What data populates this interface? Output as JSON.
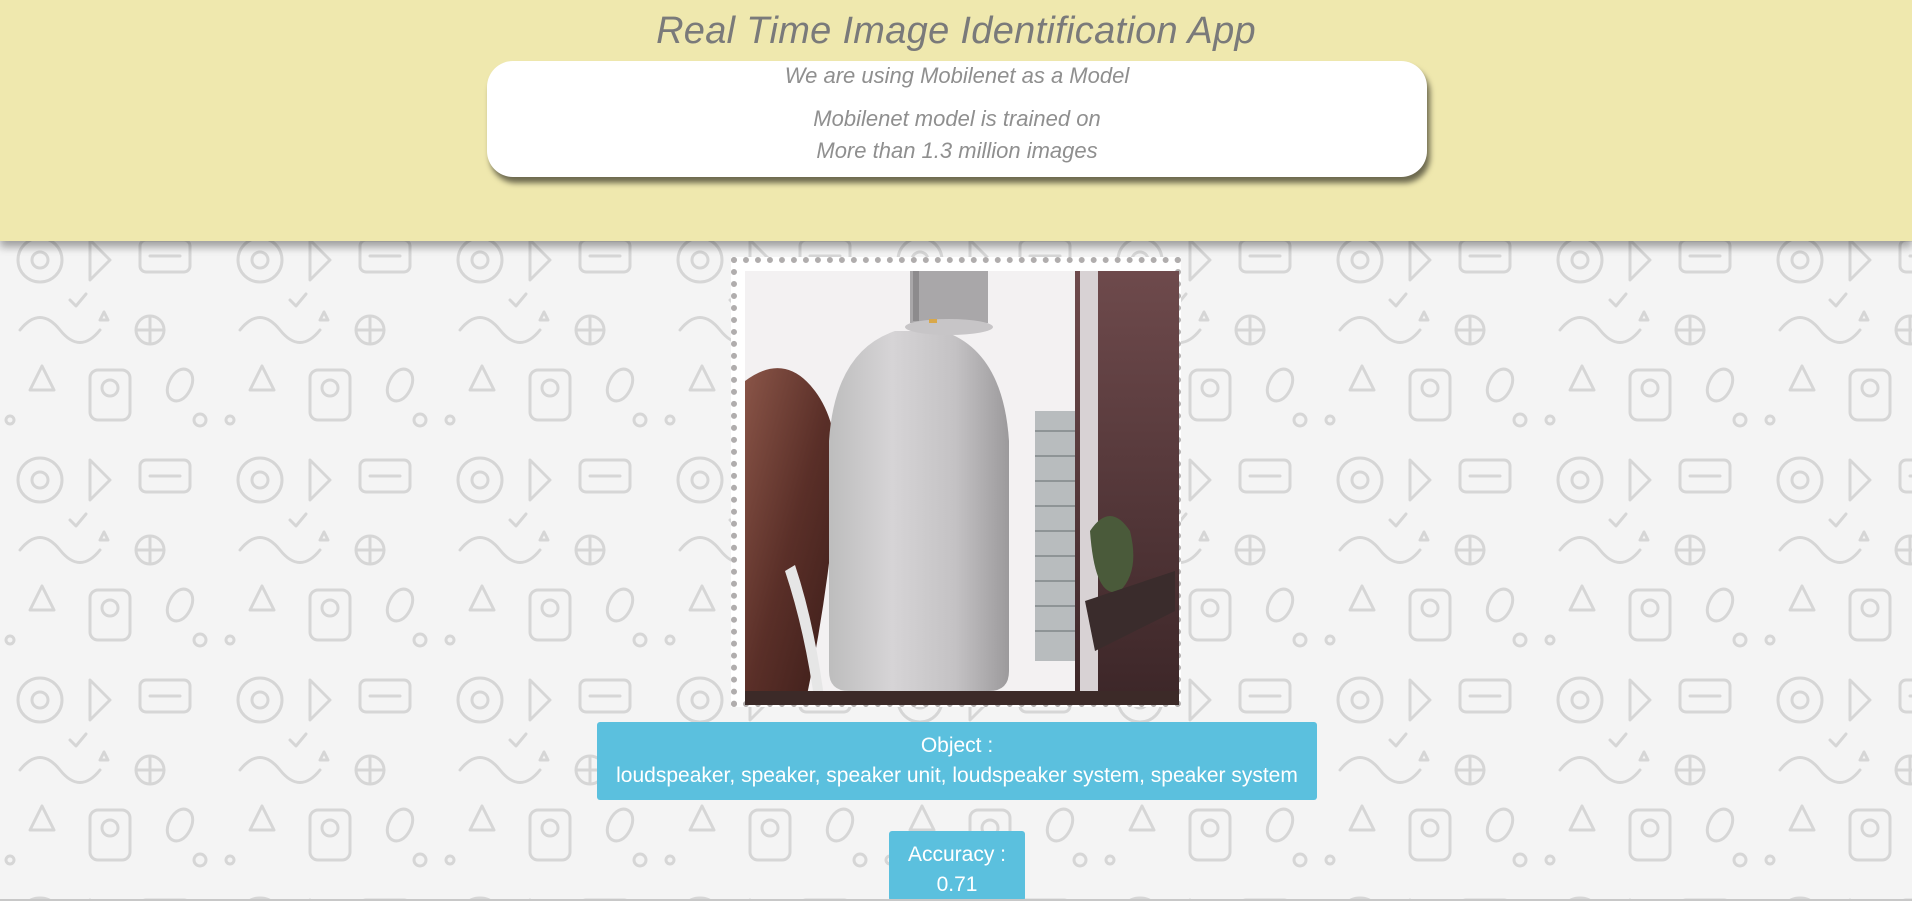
{
  "header": {
    "title": "Real Time Image Identification App",
    "background_color": "#efe8ae"
  },
  "info": {
    "line1": "We are using Mobilenet as a Model",
    "line2": "Mobilenet model is trained on",
    "line3": "More than 1.3 million images"
  },
  "result": {
    "object_label": "Object :",
    "object_value": "loudspeaker, speaker, speaker unit, loudspeaker system, speaker system",
    "accuracy_label": "Accuracy :",
    "accuracy_value": "0.71",
    "box_color": "#5bc0de"
  },
  "icons": {
    "camera_feed": "webcam-video-feed",
    "background": "doodle-pattern"
  }
}
